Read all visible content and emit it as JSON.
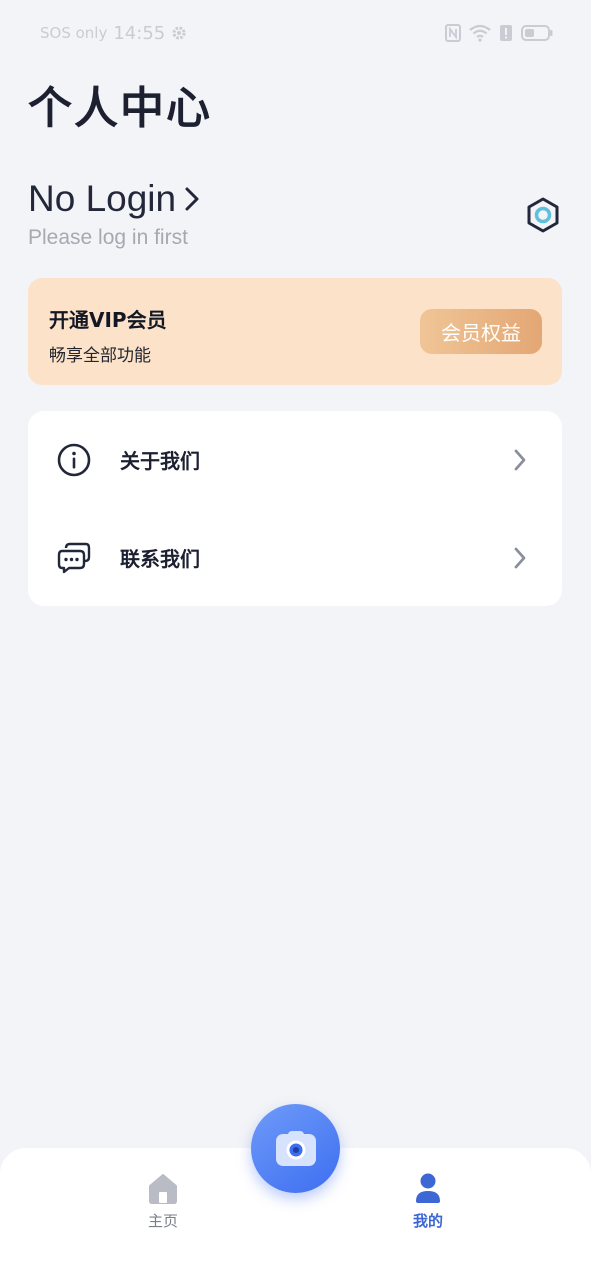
{
  "status_bar": {
    "carrier": "SOS only",
    "time": "14:55"
  },
  "header": {
    "title": "个人中心"
  },
  "login": {
    "title": "No Login",
    "subtitle": "Please log in first"
  },
  "vip": {
    "title": "开通VIP会员",
    "subtitle": "畅享全部功能",
    "button_label": "会员权益"
  },
  "menu": {
    "items": [
      {
        "label": "关于我们",
        "icon": "info-icon"
      },
      {
        "label": "联系我们",
        "icon": "chat-icon"
      }
    ]
  },
  "tabbar": {
    "tabs": [
      {
        "label": "主页",
        "icon": "home-icon",
        "active": false
      },
      {
        "label": "我的",
        "icon": "user-icon",
        "active": true
      }
    ],
    "center_icon": "camera-icon"
  },
  "colors": {
    "background": "#f3f4f7",
    "accent": "#3e67d6",
    "vip_card": "#fbe2c9",
    "vip_button": "#e3a774"
  }
}
